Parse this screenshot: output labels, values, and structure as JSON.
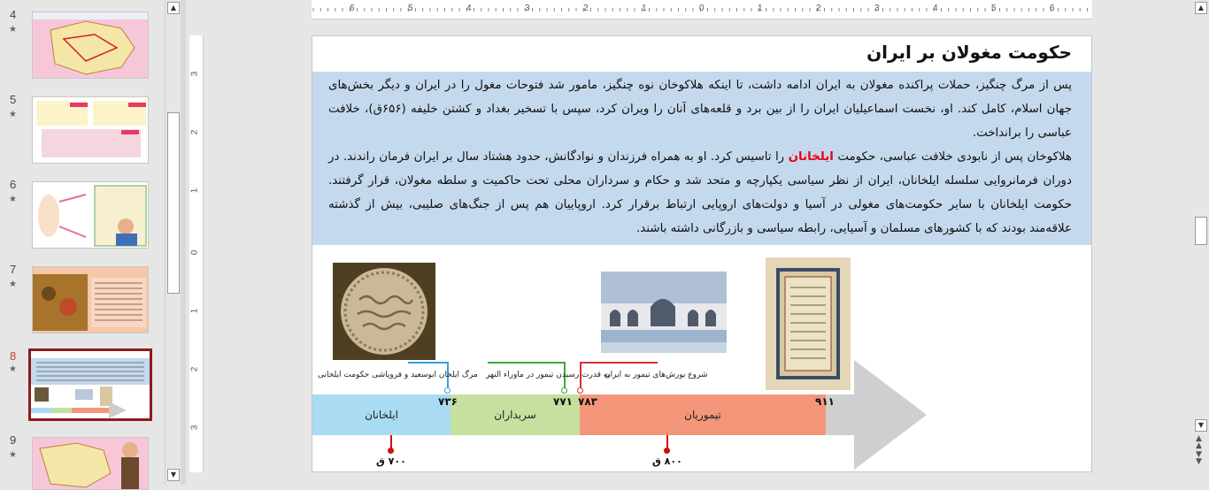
{
  "thumbnails": [
    {
      "number": "4",
      "star": "★",
      "theme": "map"
    },
    {
      "number": "5",
      "star": "★",
      "theme": "text-cards"
    },
    {
      "number": "6",
      "star": "★",
      "theme": "diagram"
    },
    {
      "number": "7",
      "star": "★",
      "theme": "painting"
    },
    {
      "number": "8",
      "star": "★",
      "theme": "current-slide",
      "active": true
    },
    {
      "number": "9",
      "star": "★",
      "theme": "map-teacher"
    }
  ],
  "ruler": {
    "h_numbers": [
      "6",
      "5",
      "4",
      "3",
      "2",
      "1",
      "0",
      "1",
      "2",
      "3",
      "4",
      "5",
      "6"
    ],
    "v_numbers": [
      "3",
      "2",
      "1",
      "0",
      "1",
      "2",
      "3"
    ]
  },
  "slide": {
    "title": "حکومت مغولان بر ایران",
    "paragraph1": "پس از مرگ چنگیز، حملات پراکنده مغولان به ایران ادامه داشت، تا اینکه هلاکوخان نوه چنگیز، مامور شد فتوحات مغول را در ایران و دیگر بخش‌های جهان اسلام، کامل کند. او، نخست اسماعیلیان ایران را از بین برد و قلعه‌های آنان را ویران کرد، سپس با تسخیر بغداد و کشتن خلیفه (۶۵۶ق)، خلافت عباسی را برانداخت.",
    "paragraph2_before": "هلاکوخان پس از نابودی خلافت عباسی، حکومت ",
    "paragraph2_highlight": "ایلخانان",
    "paragraph2_after": " را تاسیس کرد. او به همراه فرزندان و نوادگانش، حدود هشتاد سال بر ایران فرمان راندند. در دوران فرمانروایی سلسله ایلخانان، ایران از نظر سیاسی یکپارچه و متحد شد و حکام و سرداران محلی تحت حاکمیت و سلطه مغولان، قرار گرفتند. حکومت ایلخانان با سایر حکومت‌های مغولی در آسیا و دولت‌های اروپایی ارتباط برقرار کرد. اروپاییان هم پس از جنگ‌های صلیبی، بیش از گذشته علاقه‌مند بودند که با کشورهای مسلمان و آسیایی، رابطه سیاسی و بازرگانی داشته باشند.",
    "highlight_color": "#e8001a",
    "timeline": {
      "segments": [
        {
          "label": "ایلخانان",
          "color": "#a9dcf2"
        },
        {
          "label": "سربداران",
          "color": "#c6e0a0"
        },
        {
          "label": "تیموریان",
          "color": "#f3967a"
        }
      ],
      "years": [
        "۷۳۶",
        "۷۷۱",
        "۷۸۳",
        "۹۱۱"
      ],
      "notes": [
        {
          "text": "مرگ ایلخان ابوسعید و فروپاشی حکومت ایلخانی",
          "color": "#3aa0dc"
        },
        {
          "text": "به قدرت رسیدن تیمور در ماوراء النهر",
          "color": "#3aaa3a"
        },
        {
          "text": "شروع یورش‌های تیمور به ایران",
          "color": "#d83030"
        }
      ],
      "markers": [
        "۷۰۰ ق",
        "۸۰۰ ق"
      ]
    }
  }
}
